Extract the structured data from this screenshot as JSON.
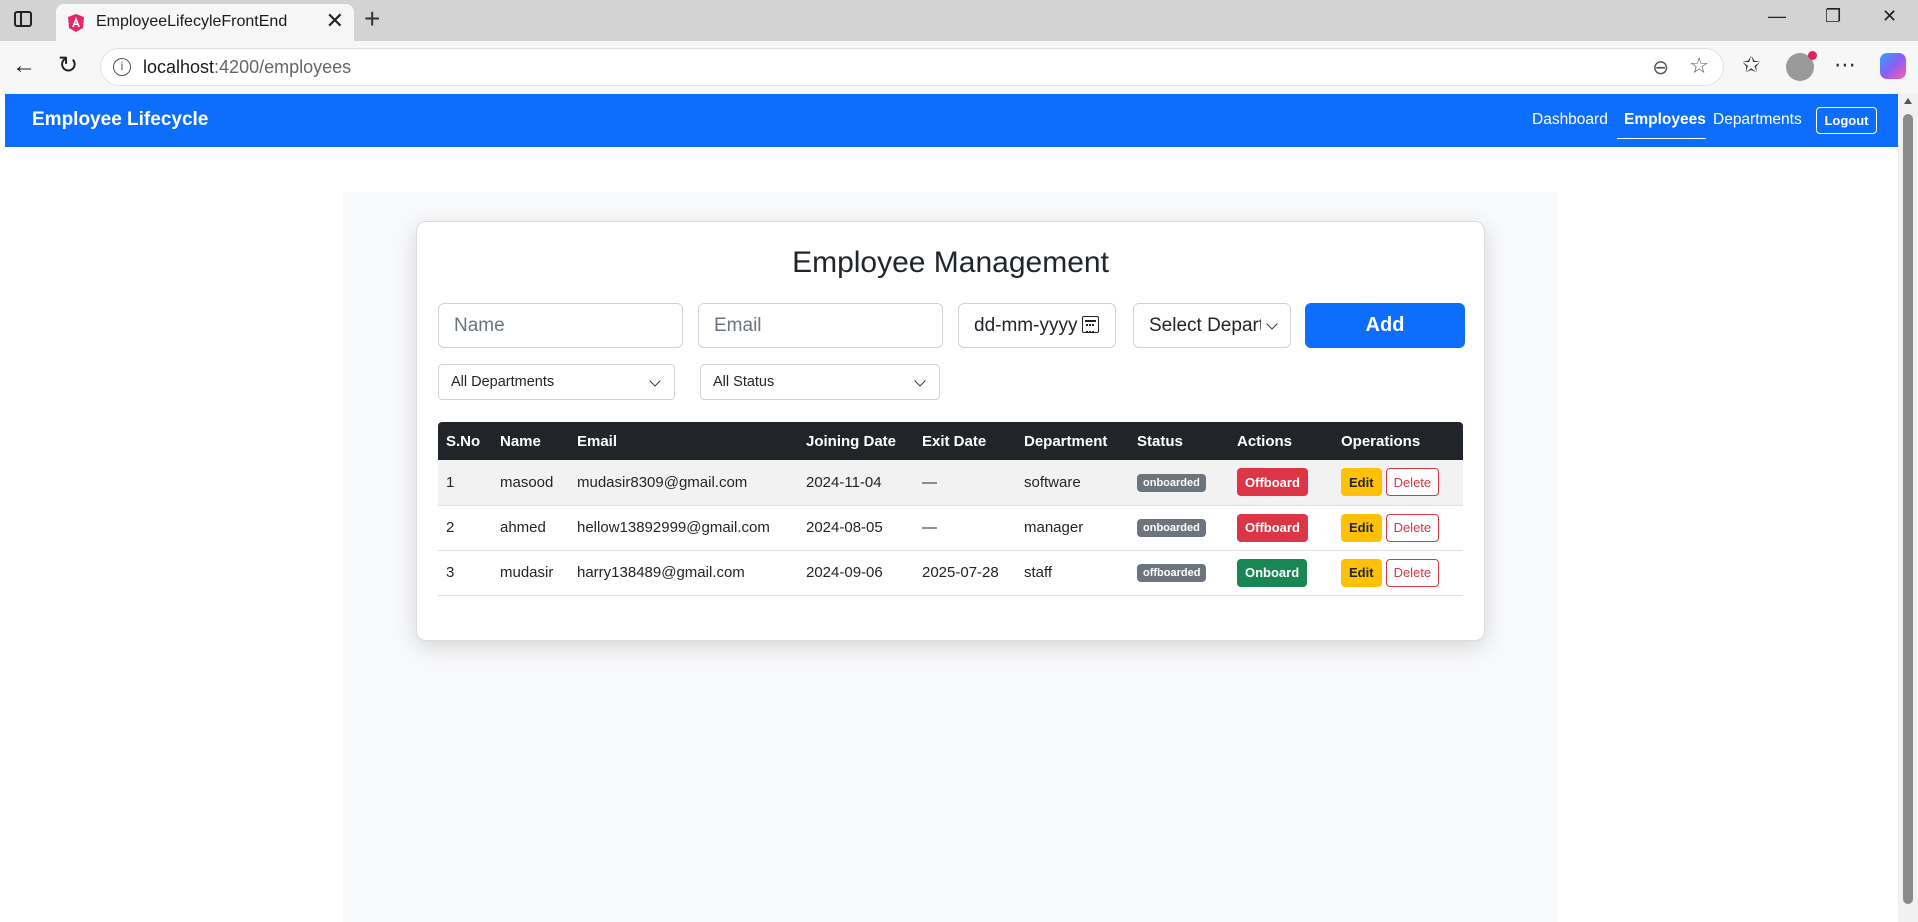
{
  "browser": {
    "tab_title": "EmployeeLifecyleFrontEnd",
    "url_host": "localhost",
    "url_path": ":4200/employees"
  },
  "navbar": {
    "brand": "Employee Lifecycle",
    "links": [
      "Dashboard",
      "Employees",
      "Departments"
    ],
    "active_link": "Employees",
    "logout_label": "Logout",
    "color": "#0d6efd"
  },
  "card": {
    "title": "Employee Management",
    "form": {
      "name_placeholder": "Name",
      "email_placeholder": "Email",
      "date_placeholder": "dd-mm-yyyy",
      "department_select": "Select Department",
      "add_label": "Add"
    },
    "filters": {
      "department": "All Departments",
      "status": "All Status"
    }
  },
  "table": {
    "headers": [
      "S.No",
      "Name",
      "Email",
      "Joining Date",
      "Exit Date",
      "Department",
      "Status",
      "Actions",
      "Operations"
    ],
    "rows": [
      {
        "sno": "1",
        "name": "masood",
        "email": "mudasir8309@gmail.com",
        "joining": "2024-11-04",
        "exit": "—",
        "department": "software",
        "status": "onboarded",
        "action": "Offboard",
        "edit": "Edit",
        "delete": "Delete"
      },
      {
        "sno": "2",
        "name": "ahmed",
        "email": "hellow13892999@gmail.com",
        "joining": "2024-08-05",
        "exit": "—",
        "department": "manager",
        "status": "onboarded",
        "action": "Offboard",
        "edit": "Edit",
        "delete": "Delete"
      },
      {
        "sno": "3",
        "name": "mudasir",
        "email": "harry138489@gmail.com",
        "joining": "2024-09-06",
        "exit": "2025-07-28",
        "department": "staff",
        "status": "offboarded",
        "action": "Onboard",
        "edit": "Edit",
        "delete": "Delete"
      }
    ]
  }
}
